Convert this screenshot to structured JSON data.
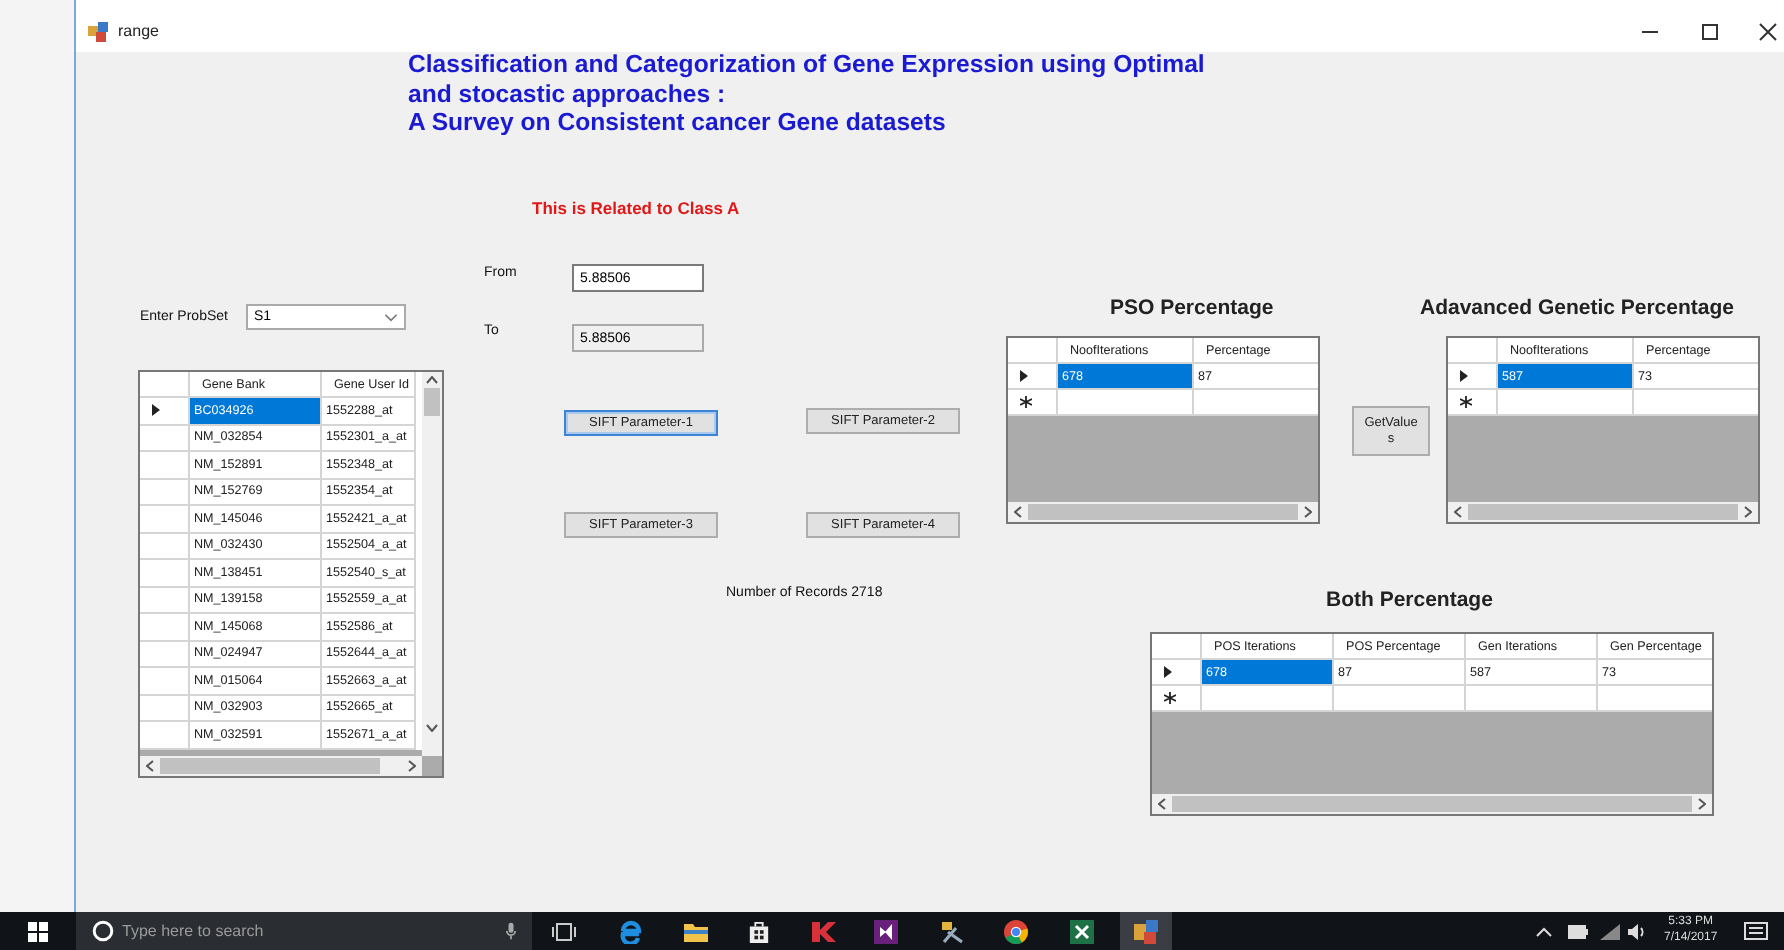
{
  "window": {
    "title": "range"
  },
  "heading": {
    "lines": [
      "Classification and Categorization of Gene Expression using Optimal",
      "and stocastic approaches :",
      "A Survey on Consistent cancer Gene datasets"
    ]
  },
  "class_note": "This is Related to Class A",
  "from": {
    "label": "From",
    "value": "5.88506"
  },
  "to": {
    "label": "To",
    "value": "5.88506",
    "disabled": true
  },
  "probset": {
    "label": "Enter ProbSet",
    "value": "S1"
  },
  "gene_grid": {
    "columns": [
      "Gene Bank",
      "Gene User Id"
    ],
    "rows": [
      {
        "current": true,
        "cells": [
          {
            "text": "BC034926",
            "selected": true
          },
          {
            "text": "1552288_at",
            "selected": false
          }
        ]
      },
      {
        "current": false,
        "cells": [
          {
            "text": "NM_032854",
            "selected": false
          },
          {
            "text": "1552301_a_at",
            "selected": false
          }
        ]
      },
      {
        "current": false,
        "cells": [
          {
            "text": "NM_152891",
            "selected": false
          },
          {
            "text": "1552348_at",
            "selected": false
          }
        ]
      },
      {
        "current": false,
        "cells": [
          {
            "text": "NM_152769",
            "selected": false
          },
          {
            "text": "1552354_at",
            "selected": false
          }
        ]
      },
      {
        "current": false,
        "cells": [
          {
            "text": "NM_145046",
            "selected": false
          },
          {
            "text": "1552421_a_at",
            "selected": false
          }
        ]
      },
      {
        "current": false,
        "cells": [
          {
            "text": "NM_032430",
            "selected": false
          },
          {
            "text": "1552504_a_at",
            "selected": false
          }
        ]
      },
      {
        "current": false,
        "cells": [
          {
            "text": "NM_138451",
            "selected": false
          },
          {
            "text": "1552540_s_at",
            "selected": false
          }
        ]
      },
      {
        "current": false,
        "cells": [
          {
            "text": "NM_139158",
            "selected": false
          },
          {
            "text": "1552559_a_at",
            "selected": false
          }
        ]
      },
      {
        "current": false,
        "cells": [
          {
            "text": "NM_145068",
            "selected": false
          },
          {
            "text": "1552586_at",
            "selected": false
          }
        ]
      },
      {
        "current": false,
        "cells": [
          {
            "text": "NM_024947",
            "selected": false
          },
          {
            "text": "1552644_a_at",
            "selected": false
          }
        ]
      },
      {
        "current": false,
        "cells": [
          {
            "text": "NM_015064",
            "selected": false
          },
          {
            "text": "1552663_a_at",
            "selected": false
          }
        ]
      },
      {
        "current": false,
        "cells": [
          {
            "text": "NM_032903",
            "selected": false
          },
          {
            "text": "1552665_at",
            "selected": false
          }
        ]
      },
      {
        "current": false,
        "cells": [
          {
            "text": "NM_032591",
            "selected": false
          },
          {
            "text": "1552671_a_at",
            "selected": false
          }
        ]
      }
    ]
  },
  "sift_buttons": [
    {
      "label": "SIFT Parameter-1",
      "focused": true
    },
    {
      "label": "SIFT Parameter-2",
      "focused": false
    },
    {
      "label": "SIFT Parameter-3",
      "focused": false
    },
    {
      "label": "SIFT Parameter-4",
      "focused": false
    }
  ],
  "record_count": "Number of Records 2718",
  "pso": {
    "title": "PSO Percentage",
    "columns": [
      "NoofIterations",
      "Percentage"
    ],
    "new_row": true,
    "rows": [
      {
        "current": true,
        "cells": [
          {
            "text": "678",
            "selected": true
          },
          {
            "text": "87",
            "selected": false
          }
        ]
      }
    ]
  },
  "get_values_button": "GetValues",
  "genetic": {
    "title": "Adavanced Genetic Percentage",
    "columns": [
      "NoofIterations",
      "Percentage"
    ],
    "new_row": true,
    "rows": [
      {
        "current": true,
        "cells": [
          {
            "text": "587",
            "selected": true
          },
          {
            "text": "73",
            "selected": false
          }
        ]
      }
    ]
  },
  "both": {
    "title": "Both Percentage",
    "columns": [
      "POS Iterations",
      "POS Percentage",
      "Gen Iterations",
      "Gen Percentage"
    ],
    "new_row": true,
    "rows": [
      {
        "current": true,
        "cells": [
          {
            "text": "678",
            "selected": true
          },
          {
            "text": "87",
            "selected": false
          },
          {
            "text": "587",
            "selected": false
          },
          {
            "text": "73",
            "selected": false
          }
        ]
      }
    ]
  },
  "taskbar": {
    "search_placeholder": "Type here to search",
    "time": "5:33 PM",
    "date": "7/14/2017"
  }
}
